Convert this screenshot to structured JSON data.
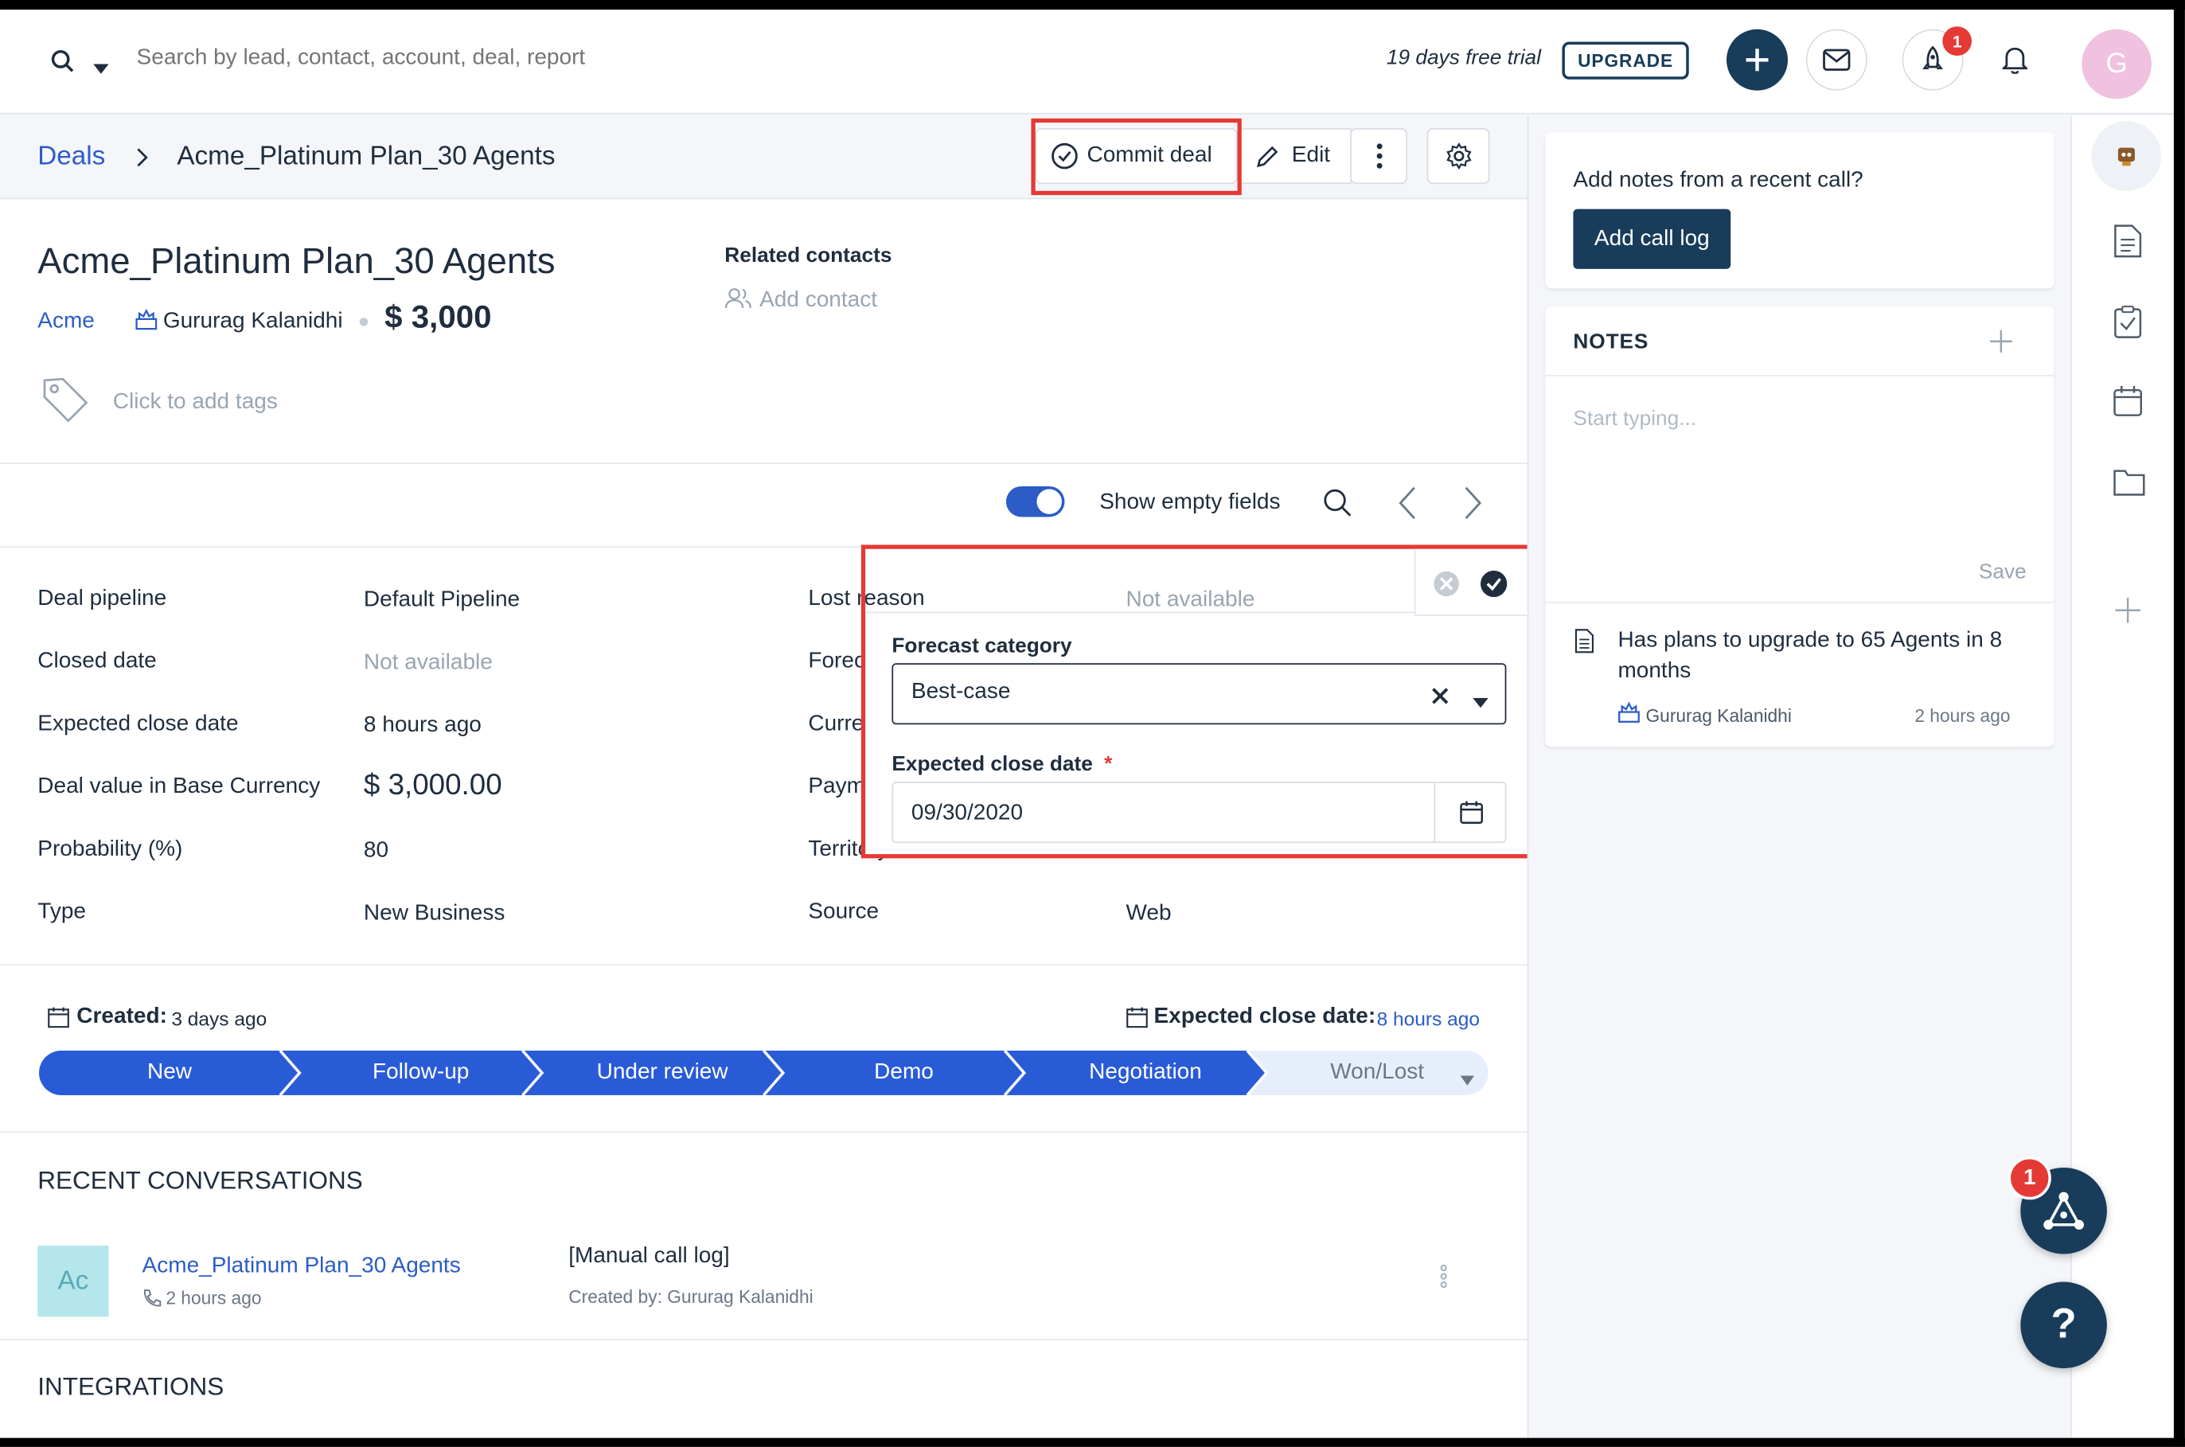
{
  "topbar": {
    "search_placeholder": "Search by lead, contact, account, deal, report",
    "trial_text": "19 days free trial",
    "upgrade_label": "UPGRADE",
    "rocket_badge": "1",
    "avatar_letter": "G"
  },
  "header": {
    "breadcrumb_root": "Deals",
    "breadcrumb_current": "Acme_Platinum Plan_30 Agents",
    "commit_label": "Commit deal",
    "edit_label": "Edit"
  },
  "deal": {
    "title": "Acme_Platinum Plan_30 Agents",
    "account": "Acme",
    "owner": "Gururag Kalanidhi",
    "amount": "$ 3,000",
    "tags_placeholder": "Click to add tags",
    "related_contacts_label": "Related contacts",
    "add_contact_label": "Add contact"
  },
  "toolbar": {
    "show_empty_label": "Show empty fields"
  },
  "fields_left": [
    {
      "label": "Deal pipeline",
      "value": "Default Pipeline"
    },
    {
      "label": "Closed date",
      "value": "Not available"
    },
    {
      "label": "Expected close date",
      "value": "8 hours ago"
    },
    {
      "label": "Deal value in Base Currency",
      "value": "$ 3,000.00"
    },
    {
      "label": "Probability (%)",
      "value": "80"
    },
    {
      "label": "Type",
      "value": "New Business"
    }
  ],
  "fields_right": [
    {
      "label": "Lost reason",
      "value": "Not available"
    },
    {
      "label": "Forecast category",
      "value": ""
    },
    {
      "label": "Currency",
      "value": ""
    },
    {
      "label": "Payment status",
      "value": ""
    },
    {
      "label": "Territory",
      "value": ""
    },
    {
      "label": "Source",
      "value": "Web"
    }
  ],
  "popup": {
    "forecast_label": "Forecast category",
    "forecast_value": "Best-case",
    "close_date_label": "Expected close date",
    "required_mark": "*",
    "close_date_value": "09/30/2020"
  },
  "timeline": {
    "created_label": "Created:",
    "created_value": "3 days ago",
    "expected_label": "Expected close date:",
    "expected_value": "8 hours ago",
    "stages": [
      "New",
      "Follow-up",
      "Under review",
      "Demo",
      "Negotiation",
      "Won/Lost"
    ]
  },
  "conversations": {
    "heading": "RECENT CONVERSATIONS",
    "avatar_text": "Ac",
    "item_title": "Acme_Platinum Plan_30 Agents",
    "item_time": "2 hours ago",
    "item_subject": "[Manual call log]",
    "item_creator": "Created by: Gururag Kalanidhi"
  },
  "integrations_heading": "INTEGRATIONS",
  "right_panel": {
    "call_prompt": "Add notes from a recent call?",
    "call_button": "Add call log",
    "notes_heading": "NOTES",
    "notes_placeholder": "Start typing...",
    "save_label": "Save",
    "note_text": "Has plans to upgrade to 65 Agents in 8 months",
    "note_author": "Gururag Kalanidhi",
    "note_time": "2 hours ago"
  },
  "floating": {
    "badge": "1",
    "help_label": "?"
  },
  "colors": {
    "primary_blue": "#2c5cc5",
    "stage_blue": "#2a5bd7",
    "navy": "#183c5a",
    "highlight_red": "#e53935"
  }
}
